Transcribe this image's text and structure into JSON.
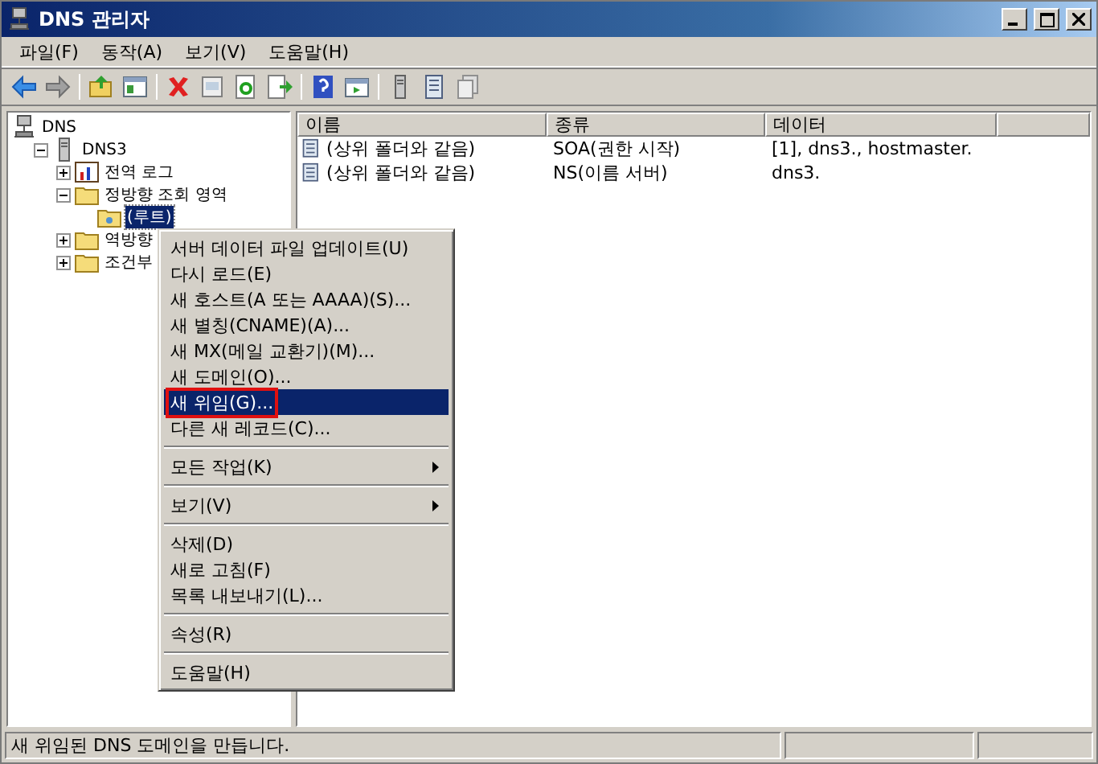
{
  "window": {
    "title": "DNS 관리자"
  },
  "menu_bar": [
    "파일(F)",
    "동작(A)",
    "보기(V)",
    "도움말(H)"
  ],
  "tree": [
    {
      "label": "DNS",
      "kind": "root",
      "selected": false,
      "children": [
        {
          "label": "DNS3",
          "kind": "server",
          "selected": false,
          "expanded": true,
          "children": [
            {
              "label": "전역 로그",
              "kind": "log",
              "selected": false,
              "expanded": false
            },
            {
              "label": "정방향 조회 영역",
              "kind": "folder",
              "selected": false,
              "expanded": true,
              "children": [
                {
                  "label": "(루트)",
                  "kind": "zone",
                  "selected": true
                }
              ]
            },
            {
              "label": "역방향",
              "kind": "folder",
              "selected": false,
              "expanded": false
            },
            {
              "label": "조건부",
              "kind": "folder",
              "selected": false,
              "expanded": false
            }
          ]
        }
      ]
    }
  ],
  "list": {
    "columns": [
      "이름",
      "종류",
      "데이터"
    ],
    "rows": [
      {
        "name": "(상위 폴더와 같음)",
        "type": "SOA(권한 시작)",
        "data": "[1], dns3., hostmaster."
      },
      {
        "name": "(상위 폴더와 같음)",
        "type": "NS(이름 서버)",
        "data": "dns3."
      }
    ]
  },
  "context_menu": [
    {
      "kind": "item",
      "label": "서버 데이터 파일 업데이트(U)",
      "selected": false
    },
    {
      "kind": "item",
      "label": "다시 로드(E)",
      "selected": false
    },
    {
      "kind": "item",
      "label": "새 호스트(A 또는 AAAA)(S)...",
      "selected": false
    },
    {
      "kind": "item",
      "label": "새 별칭(CNAME)(A)...",
      "selected": false
    },
    {
      "kind": "item",
      "label": "새 MX(메일 교환기)(M)...",
      "selected": false
    },
    {
      "kind": "item",
      "label": "새 도메인(O)...",
      "selected": false
    },
    {
      "kind": "item",
      "label": "새 위임(G)...",
      "selected": true,
      "outlined": true
    },
    {
      "kind": "item",
      "label": "다른 새 레코드(C)...",
      "selected": false
    },
    {
      "kind": "separator"
    },
    {
      "kind": "submenu",
      "label": "모든 작업(K)",
      "selected": false
    },
    {
      "kind": "separator"
    },
    {
      "kind": "submenu",
      "label": "보기(V)",
      "selected": false
    },
    {
      "kind": "separator"
    },
    {
      "kind": "item",
      "label": "삭제(D)",
      "selected": false
    },
    {
      "kind": "item",
      "label": "새로 고침(F)",
      "selected": false
    },
    {
      "kind": "item",
      "label": "목록 내보내기(L)...",
      "selected": false
    },
    {
      "kind": "separator"
    },
    {
      "kind": "item",
      "label": "속성(R)",
      "selected": false
    },
    {
      "kind": "separator"
    },
    {
      "kind": "item",
      "label": "도움말(H)",
      "selected": false
    }
  ],
  "status_bar": {
    "text": "새 위임된 DNS 도메인을 만듭니다."
  }
}
